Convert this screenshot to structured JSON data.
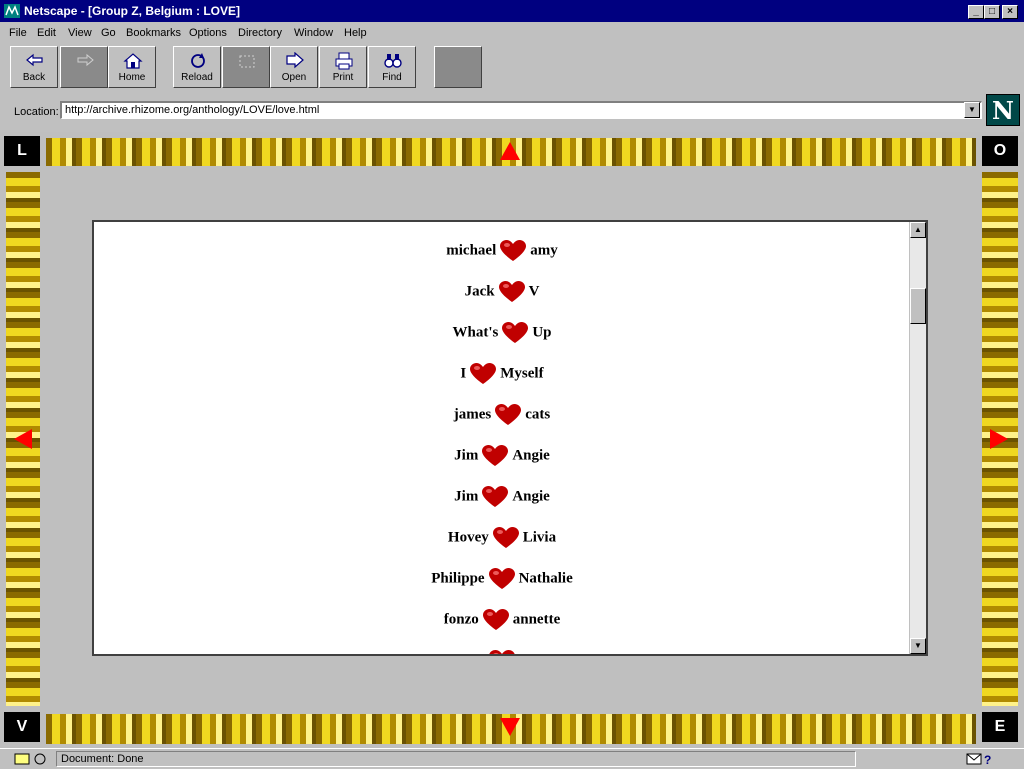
{
  "window": {
    "title": "Netscape - [Group Z, Belgium : LOVE]"
  },
  "menu": [
    "File",
    "Edit",
    "View",
    "Go",
    "Bookmarks",
    "Options",
    "Directory",
    "Window",
    "Help"
  ],
  "toolbar": {
    "back": "Back",
    "home": "Home",
    "reload": "Reload",
    "open": "Open",
    "print": "Print",
    "find": "Find"
  },
  "location": {
    "label": "Location:",
    "url": "http://archive.rhizome.org/anthology/LOVE/love.html"
  },
  "frame_letters": {
    "top_left": "L",
    "top_right": "O",
    "bottom_left": "V",
    "bottom_right": "E"
  },
  "love_pairs": [
    {
      "left": "michael",
      "right": "amy"
    },
    {
      "left": "Jack",
      "right": "V"
    },
    {
      "left": "What's",
      "right": "Up"
    },
    {
      "left": "I",
      "right": "Myself"
    },
    {
      "left": "james",
      "right": "cats"
    },
    {
      "left": "Jim",
      "right": "Angie"
    },
    {
      "left": "Jim",
      "right": "Angie"
    },
    {
      "left": "Hovey",
      "right": "Livia"
    },
    {
      "left": "Philippe",
      "right": "Nathalie"
    },
    {
      "left": "fonzo",
      "right": "annette"
    }
  ],
  "colors": {
    "heart": "#c00000",
    "arrow": "#ff0000",
    "titlebar": "#000080"
  },
  "status": {
    "text": "Document: Done"
  }
}
